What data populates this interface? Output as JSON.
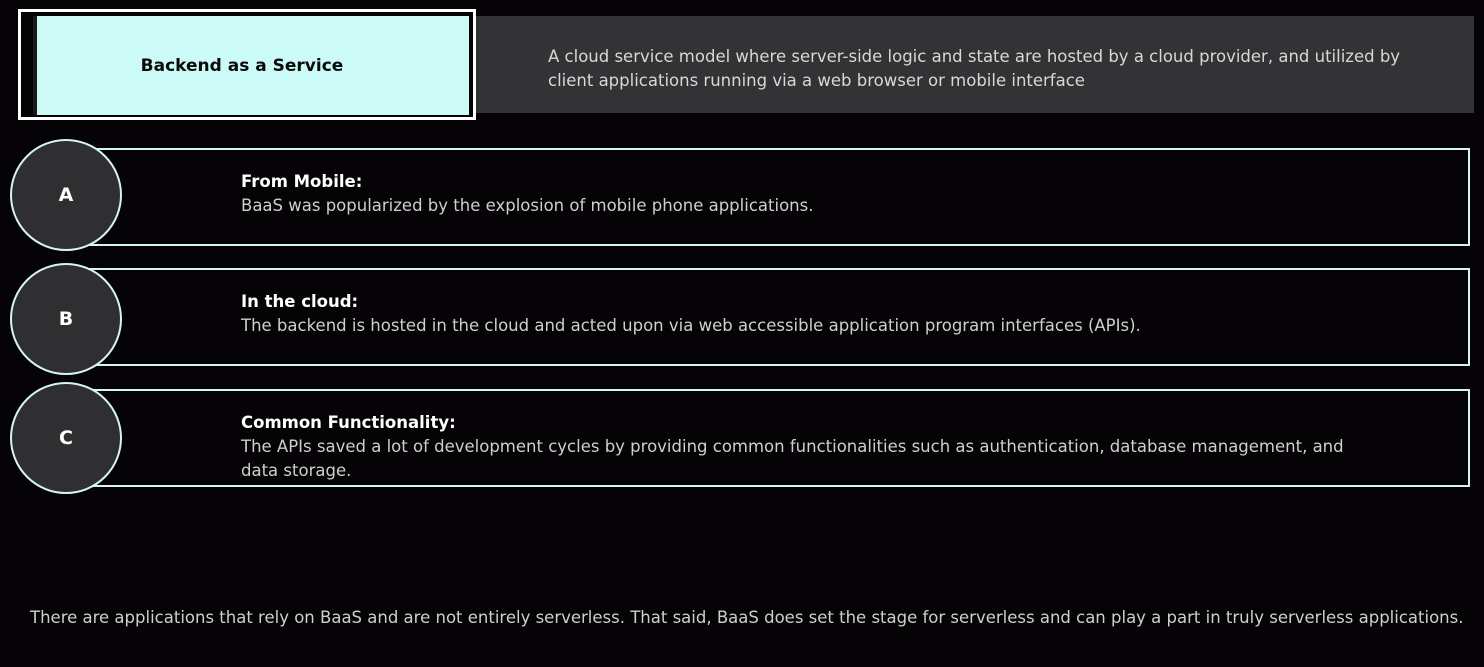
{
  "header": {
    "title": "Backend as a Service",
    "description": "A cloud service model where server-side logic and state are hosted by a cloud provider, and utilized by client applications running via a web browser or mobile interface"
  },
  "items": [
    {
      "letter": "A",
      "heading": "From Mobile:",
      "body": "BaaS was popularized by the explosion of mobile phone applications."
    },
    {
      "letter": "B",
      "heading": "In the cloud:",
      "body": "The backend is hosted in the cloud and acted upon via web accessible application program interfaces (APIs)."
    },
    {
      "letter": "C",
      "heading": "Common Functionality:",
      "body": "The APIs saved a lot of development cycles by providing common functionalities such as authentication, database management, and data storage."
    }
  ],
  "footer": {
    "note": "There are applications that rely on BaaS and are not entirely serverless.  That said, BaaS does set the stage for serverless and can play a part in truly serverless applications."
  }
}
